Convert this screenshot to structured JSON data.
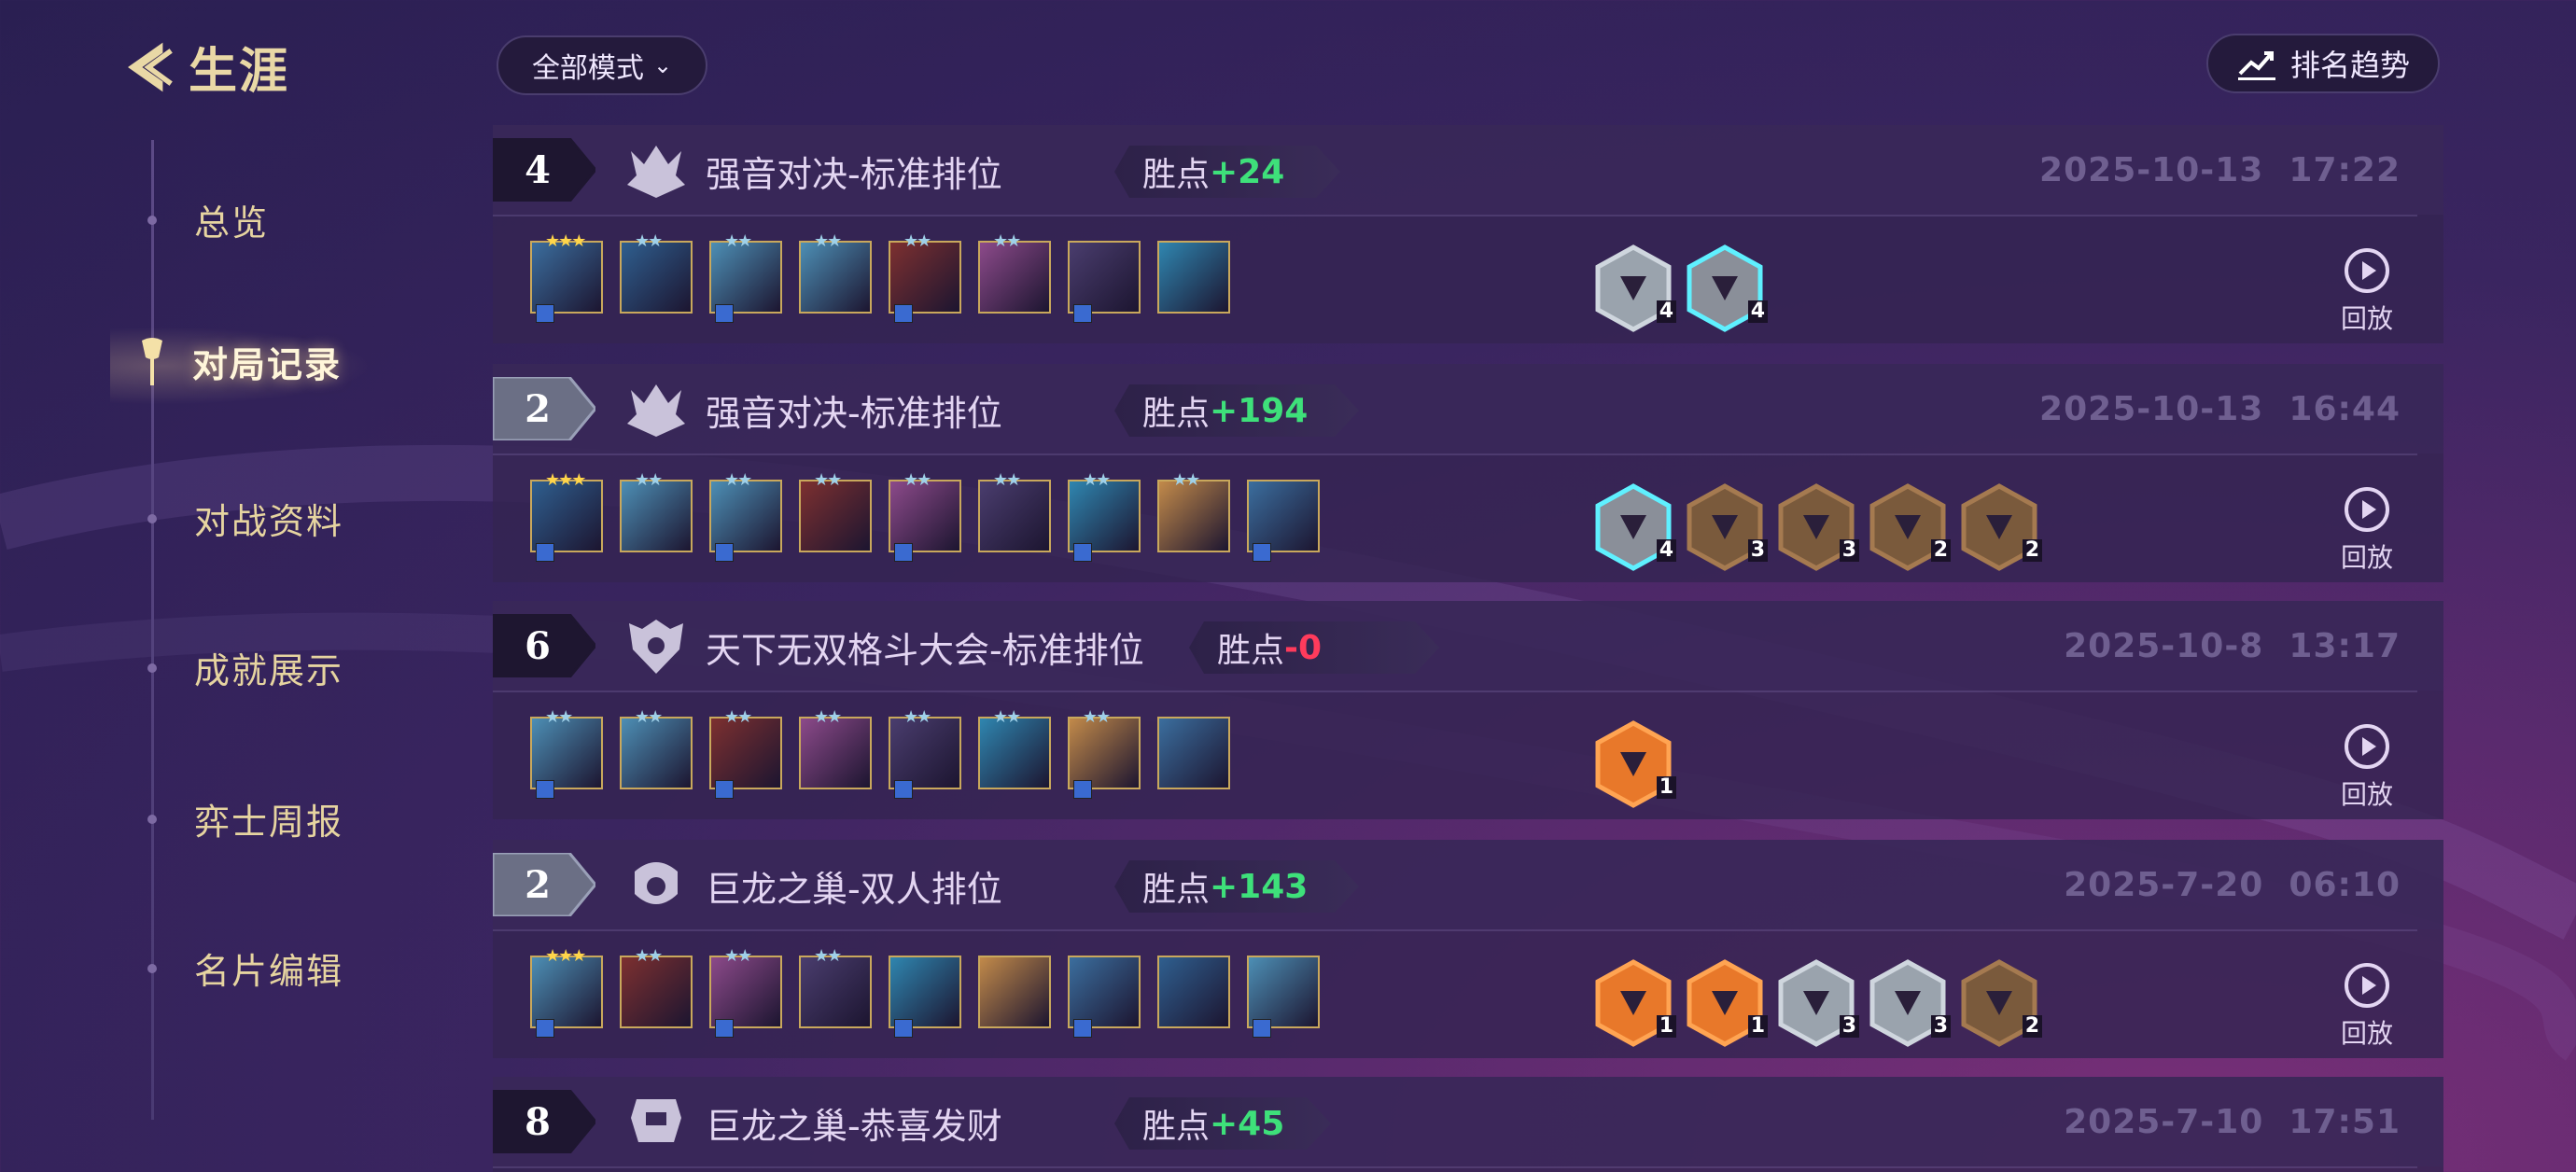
{
  "header": {
    "title": "生涯",
    "mode_filter": "全部模式",
    "trend_button": "排名趋势"
  },
  "sidebar": {
    "items": [
      {
        "label": "总览",
        "active": false
      },
      {
        "label": "对局记录",
        "active": true
      },
      {
        "label": "对战资料",
        "active": false
      },
      {
        "label": "成就展示",
        "active": false
      },
      {
        "label": "弈士周报",
        "active": false
      },
      {
        "label": "名片编辑",
        "active": false
      }
    ]
  },
  "colors": {
    "gain": "#3ee07a",
    "loss": "#ff3b5c",
    "gold": "#e9d8a6",
    "date": "#6f5f90"
  },
  "matches": [
    {
      "rank": "4",
      "mode": "强音对决-标准排位",
      "points_label": "胜点",
      "points_delta": "+24",
      "date": "2025-10-13",
      "time": "17:22",
      "units": [
        "3star",
        "2star",
        "2star",
        "2star",
        "2star",
        "2star",
        "1star",
        "1star"
      ],
      "traits": [
        {
          "count": "4",
          "tier": "silver"
        },
        {
          "count": "4",
          "tier": "prismatic"
        }
      ],
      "replay": "回放"
    },
    {
      "rank": "2",
      "mode": "强音对决-标准排位",
      "points_label": "胜点",
      "points_delta": "+194",
      "date": "2025-10-13",
      "time": "16:44",
      "units": [
        "3star",
        "2star",
        "2star",
        "2star",
        "2star",
        "2star",
        "2star",
        "2star",
        "1star"
      ],
      "traits": [
        {
          "count": "4",
          "tier": "prismatic"
        },
        {
          "count": "3",
          "tier": "bronze"
        },
        {
          "count": "3",
          "tier": "bronze"
        },
        {
          "count": "2",
          "tier": "bronze"
        },
        {
          "count": "2",
          "tier": "bronze"
        }
      ],
      "replay": "回放"
    },
    {
      "rank": "6",
      "mode": "天下无双格斗大会-标准排位",
      "points_label": "胜点",
      "points_delta": "-0",
      "date": "2025-10-8",
      "time": "13:17",
      "units": [
        "2star",
        "2star",
        "2star",
        "2star",
        "2star",
        "2star",
        "2star",
        "1star"
      ],
      "traits": [
        {
          "count": "1",
          "tier": "unique"
        }
      ],
      "replay": "回放"
    },
    {
      "rank": "2",
      "mode": "巨龙之巢-双人排位",
      "points_label": "胜点",
      "points_delta": "+143",
      "date": "2025-7-20",
      "time": "06:10",
      "units": [
        "3star",
        "2star",
        "2star",
        "2star",
        "1star",
        "1star",
        "1star",
        "1star",
        "1star"
      ],
      "traits": [
        {
          "count": "1",
          "tier": "unique"
        },
        {
          "count": "1",
          "tier": "unique"
        },
        {
          "count": "3",
          "tier": "silver"
        },
        {
          "count": "3",
          "tier": "silver"
        },
        {
          "count": "2",
          "tier": "bronze"
        }
      ],
      "replay": "回放"
    },
    {
      "rank": "8",
      "mode": "巨龙之巢-恭喜发财",
      "points_label": "胜点",
      "points_delta": "+45",
      "date": "2025-7-10",
      "time": "17:51"
    }
  ]
}
